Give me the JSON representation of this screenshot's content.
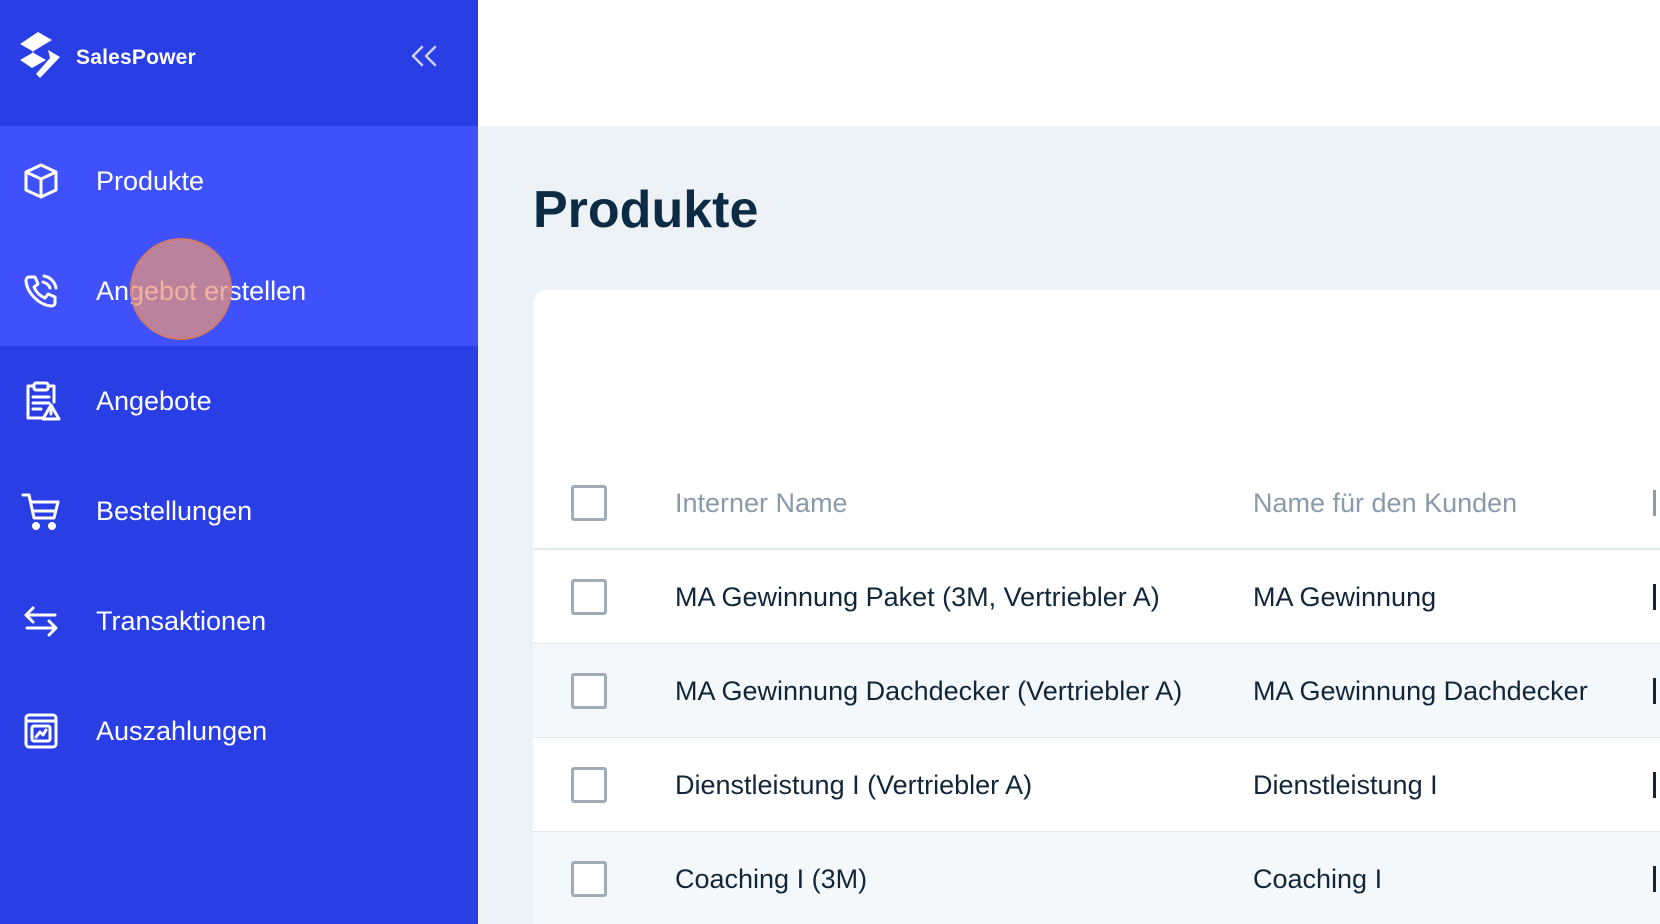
{
  "brand": {
    "name": "SalesPower"
  },
  "sidebar": {
    "collapse_icon": "chevrons-left-icon",
    "items": [
      {
        "label": "Produkte",
        "icon": "box-icon",
        "active": true
      },
      {
        "label": "Angebot erstellen",
        "icon": "phone-icon",
        "active": true
      },
      {
        "label": "Angebote",
        "icon": "clipboard-warning-icon",
        "active": false
      },
      {
        "label": "Bestellungen",
        "icon": "cart-icon",
        "active": false
      },
      {
        "label": "Transaktionen",
        "icon": "arrows-exchange-icon",
        "active": false
      },
      {
        "label": "Auszahlungen",
        "icon": "payout-icon",
        "active": false
      }
    ]
  },
  "main": {
    "title": "Produkte",
    "table": {
      "columns": [
        "Interner Name",
        "Name für den Kunden"
      ],
      "rows": [
        {
          "internal": "MA Gewinnung Paket (3M, Vertriebler A)",
          "customer": "MA Gewinnung"
        },
        {
          "internal": "MA Gewinnung Dachdecker (Vertriebler A)",
          "customer": "MA Gewinnung Dachdecker"
        },
        {
          "internal": "Dienstleistung I (Vertriebler A)",
          "customer": "Dienstleistung I"
        },
        {
          "internal": "Coaching I (3M)",
          "customer": "Coaching I"
        }
      ]
    }
  },
  "colors": {
    "sidebar": "#2a3ee6",
    "sidebar_active": "#3f51fb",
    "title": "#0d2b45",
    "background": "#edf2f7"
  }
}
